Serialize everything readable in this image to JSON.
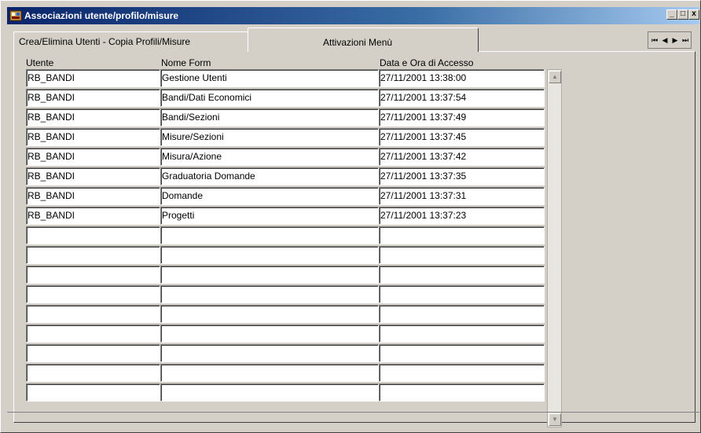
{
  "window": {
    "title": "Associazioni utente/profilo/misure",
    "icon": "app-icon",
    "controls": {
      "minimize": "_",
      "maximize": "□",
      "close": "x"
    }
  },
  "tabs": [
    {
      "label": "Crea/Elimina Utenti - Copia Profili/Misure",
      "active": false
    },
    {
      "label": "Attivazioni Menù",
      "active": true
    }
  ],
  "nav": {
    "first": "⏮",
    "prev": "◀",
    "next": "▶",
    "last": "⏭"
  },
  "grid": {
    "headers": {
      "user": "Utente",
      "form": "Nome Form",
      "datetime": "Data e Ora di Accesso"
    },
    "rows": [
      {
        "user": "RB_BANDI",
        "form": "Gestione Utenti",
        "datetime": "27/11/2001 13:38:00"
      },
      {
        "user": "RB_BANDI",
        "form": "Bandi/Dati Economici",
        "datetime": "27/11/2001 13:37:54"
      },
      {
        "user": "RB_BANDI",
        "form": "Bandi/Sezioni",
        "datetime": "27/11/2001 13:37:49"
      },
      {
        "user": "RB_BANDI",
        "form": "Misure/Sezioni",
        "datetime": "27/11/2001 13:37:45"
      },
      {
        "user": "RB_BANDI",
        "form": "Misura/Azione",
        "datetime": "27/11/2001 13:37:42"
      },
      {
        "user": "RB_BANDI",
        "form": "Graduatoria Domande",
        "datetime": "27/11/2001 13:37:35"
      },
      {
        "user": "RB_BANDI",
        "form": "Domande",
        "datetime": "27/11/2001 13:37:31"
      },
      {
        "user": "RB_BANDI",
        "form": "Progetti",
        "datetime": "27/11/2001 13:37:23"
      },
      {
        "user": "",
        "form": "",
        "datetime": ""
      },
      {
        "user": "",
        "form": "",
        "datetime": ""
      },
      {
        "user": "",
        "form": "",
        "datetime": ""
      },
      {
        "user": "",
        "form": "",
        "datetime": ""
      },
      {
        "user": "",
        "form": "",
        "datetime": ""
      },
      {
        "user": "",
        "form": "",
        "datetime": ""
      },
      {
        "user": "",
        "form": "",
        "datetime": ""
      },
      {
        "user": "",
        "form": "",
        "datetime": ""
      },
      {
        "user": "",
        "form": "",
        "datetime": ""
      }
    ]
  },
  "scrollbar": {
    "up": "▲",
    "down": "▼"
  },
  "colors": {
    "titlebar_start": "#0a246a",
    "titlebar_end": "#a6caf0",
    "face": "#d4d0c8",
    "cell_bg": "#ffffff"
  }
}
